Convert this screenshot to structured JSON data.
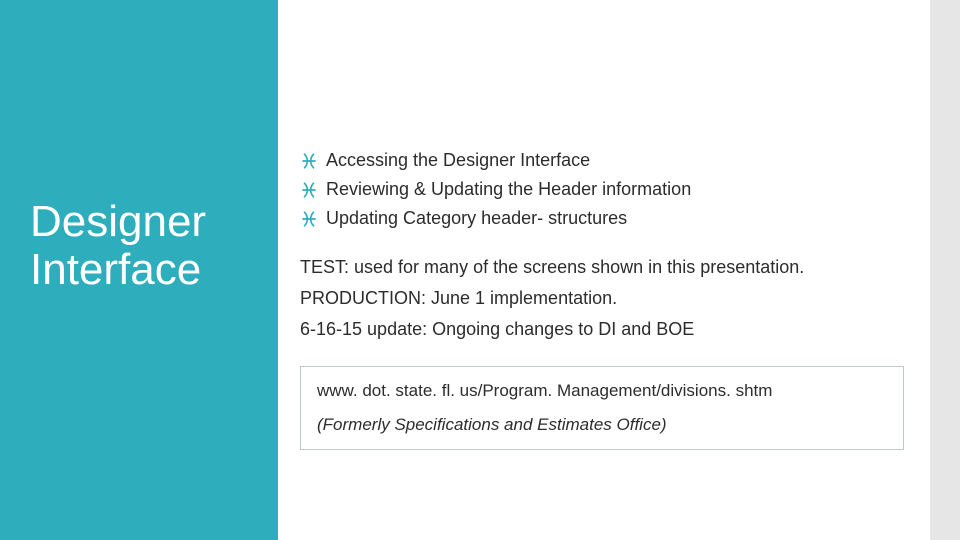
{
  "sidebar": {
    "title_line1": "Designer",
    "title_line2": "Interface"
  },
  "bullets": {
    "b0": "Accessing the Designer Interface",
    "b1": "Reviewing & Updating the Header information",
    "b2": "Updating Category header- structures"
  },
  "paragraphs": {
    "p0_head": "TEST:",
    "p0_rest": " used for many of the screens shown in this presentation.",
    "p1_head": "PRODUCTION:",
    "p1_rest": " June 1 implementation.",
    "p2": "6-16-15 update: Ongoing changes to DI and BOE"
  },
  "linkbox": {
    "url": "www. dot. state. fl. us/Program. Management/divisions. shtm",
    "sub": "(Formerly Specifications and Estimates Office)"
  },
  "colors": {
    "accent": "#2eadbd"
  }
}
